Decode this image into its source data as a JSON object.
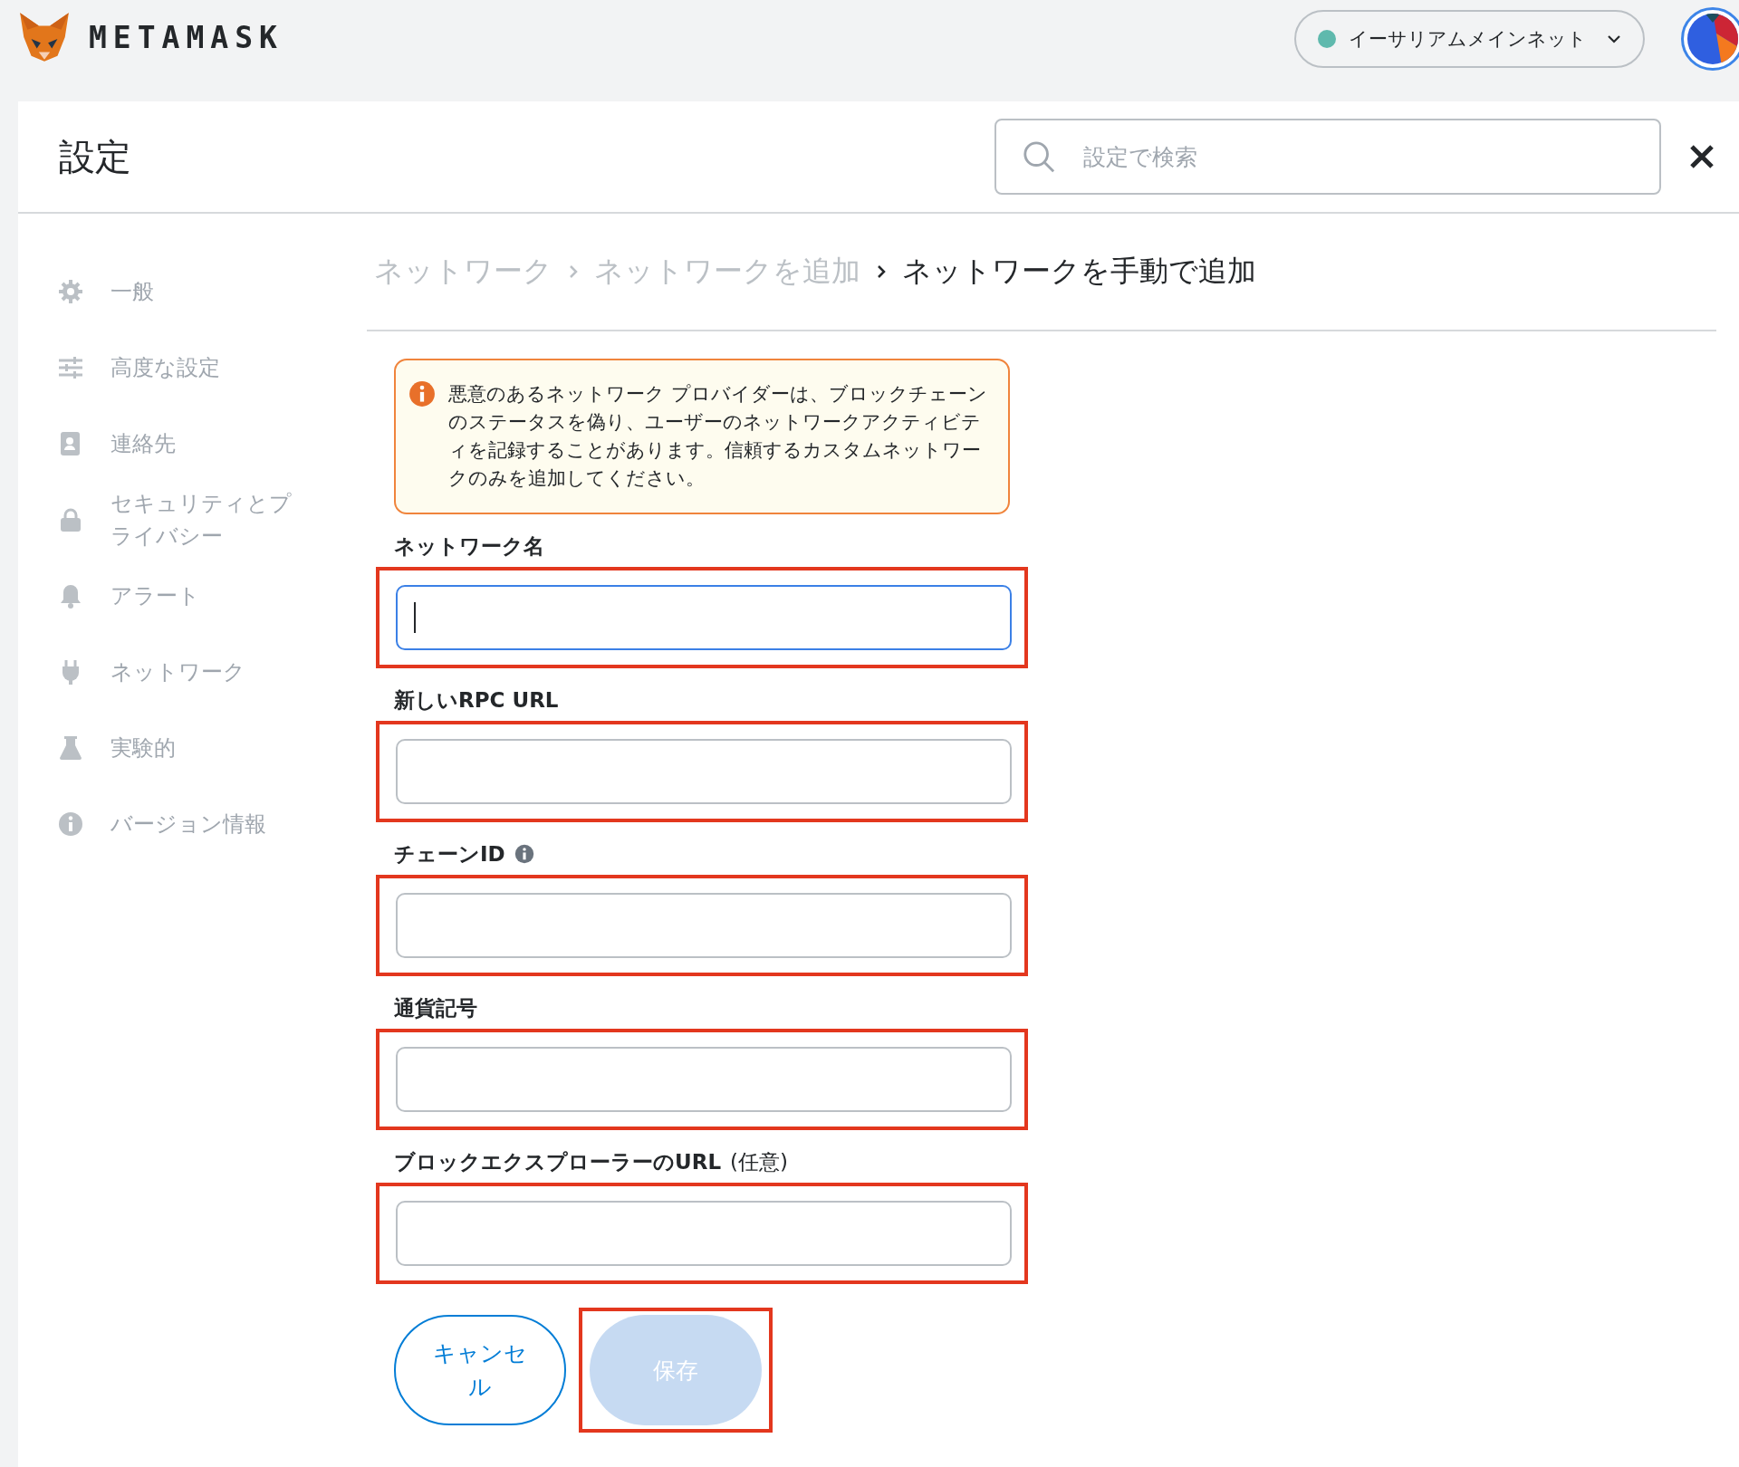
{
  "header": {
    "logo_text": "METAMASK",
    "network": {
      "label": "イーサリアムメインネット",
      "color": "#5fb9ad"
    }
  },
  "settings": {
    "title": "設定",
    "search": {
      "placeholder": "設定で検索"
    }
  },
  "sidebar": {
    "items": [
      {
        "kind": "gear",
        "label": "一般"
      },
      {
        "kind": "sliders",
        "label": "高度な設定"
      },
      {
        "kind": "contact",
        "label": "連絡先"
      },
      {
        "kind": "lock",
        "label": "セキュリティとプライバシー"
      },
      {
        "kind": "bell",
        "label": "アラート"
      },
      {
        "kind": "plug",
        "label": "ネットワーク"
      },
      {
        "kind": "flask",
        "label": "実験的"
      },
      {
        "kind": "info",
        "label": "バージョン情報"
      }
    ]
  },
  "breadcrumb": [
    {
      "label": "ネットワーク",
      "current": false
    },
    {
      "label": "ネットワークを追加",
      "current": false
    },
    {
      "label": "ネットワークを手動で追加",
      "current": true
    }
  ],
  "warning": {
    "text": "悪意のあるネットワーク プロバイダーは、ブロックチェーンのステータスを偽り、ユーザーのネットワークアクティビティを記録することがあります。信頼するカスタムネットワークのみを追加してください。"
  },
  "fields": [
    {
      "label": "ネットワーク名",
      "focused": true,
      "info": false,
      "highlighted": true
    },
    {
      "label": "新しいRPC URL",
      "focused": false,
      "info": false,
      "highlighted": true
    },
    {
      "label": "チェーンID",
      "focused": false,
      "info": true,
      "highlighted": true
    },
    {
      "label": "通貨記号",
      "focused": false,
      "info": false,
      "highlighted": true
    },
    {
      "label": "ブロックエクスプローラーのURL",
      "note": "(任意)",
      "focused": false,
      "info": false,
      "highlighted": true
    }
  ],
  "buttons": {
    "cancel": {
      "label": "キャンセル"
    },
    "save": {
      "label": "保存",
      "disabled": true,
      "highlighted": true
    }
  }
}
